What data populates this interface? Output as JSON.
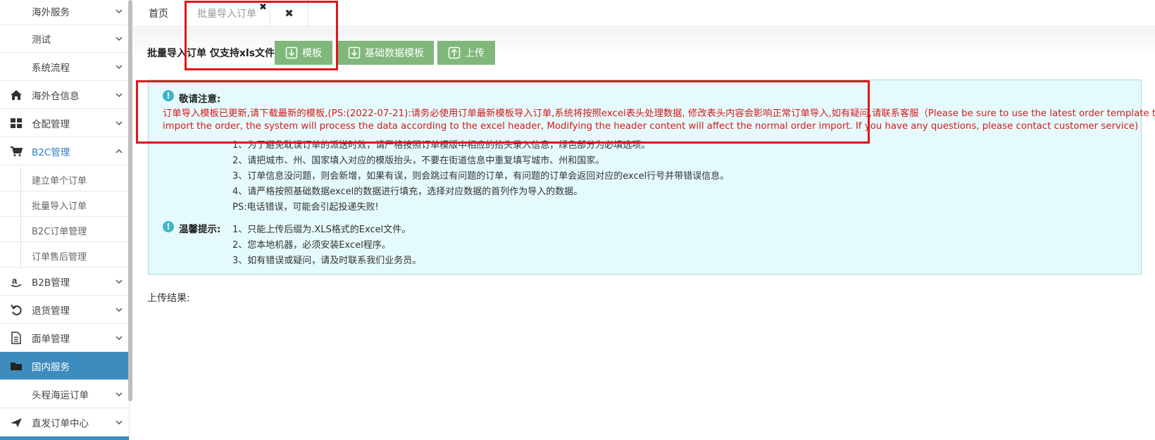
{
  "sidebar": {
    "items": [
      {
        "label": "海外服务",
        "icon": "none"
      },
      {
        "label": "测试",
        "icon": "none"
      },
      {
        "label": "系统流程",
        "icon": "none"
      },
      {
        "label": "海外仓信息",
        "icon": "home-icon"
      },
      {
        "label": "仓配管理",
        "icon": "grid-icon"
      },
      {
        "label": "B2C管理",
        "icon": "cart-icon"
      },
      {
        "label": "B2B管理",
        "icon": "amazon-icon"
      },
      {
        "label": "退货管理",
        "icon": "undo-icon"
      },
      {
        "label": "面单管理",
        "icon": "document-icon"
      },
      {
        "label": "国内服务",
        "icon": "folder-icon"
      },
      {
        "label": "头程海运订单",
        "icon": "none"
      },
      {
        "label": "直发订单中心",
        "icon": "plane-icon"
      }
    ],
    "b2c_sub": [
      "建立单个订单",
      "批量导入订单",
      "B2C订单管理",
      "订单售后管理"
    ]
  },
  "tabs": {
    "home": "首页",
    "current": "批量导入订单",
    "close_glyph": "✖",
    "close_all_glyph": "✖"
  },
  "toolbar": {
    "title": "批量导入订单 仅支持xls文件",
    "template_button": "模板",
    "base_template_button": "基础数据模板",
    "upload_button": "上传"
  },
  "notice": {
    "icon_glyph": "!",
    "heading": "敬请注意:",
    "red_line_1": "订单导入模板已更新,请下载最新的模板,(PS:(2022-07-21):请务必使用订单最新模板导入订单,系统将按照excel表头处理数据, 修改表头内容会影响正常订单导入,如有疑问,请联系客服（Please be sure to use the latest order template to",
    "red_line_2": "import the order, the system will process the data according to the excel header, Modifying the header content will affect the normal order import. If you have any questions, please contact customer service)",
    "lines": [
      "1、为了避免耽误订单的派送时效，请严格按照订单模版中相应的抬头录入信息，绿色部分为必填选项。",
      "2、请把城市、州、国家填入对应的模版抬头，不要在街道信息中重复填写城市、州和国家。",
      "3、订单信息没问题，则会新增，如果有误，则会跳过有问题的订单，有问题的订单会返回对应的excel行号并带错误信息。",
      "4、请严格按照基础数据excel的数据进行填充，选择对应数据的首列作为导入的数据。",
      "PS:电话错误，可能会引起投递失败!"
    ],
    "tips_heading": "温馨提示:",
    "tips": [
      "1、只能上传后缀为.XLS格式的Excel文件。",
      "2、您本地机器，必须安装Excel程序。",
      "3、如有错误或疑问，请及时联系我们业务员。"
    ]
  },
  "result_label": "上传结果:",
  "colors": {
    "button_green": "#7fb87a",
    "active_blue": "#3d8cbd",
    "notice_bg": "#e5fafc",
    "alert_red": "#d51b1b",
    "highlight_box": "#e2141c"
  }
}
